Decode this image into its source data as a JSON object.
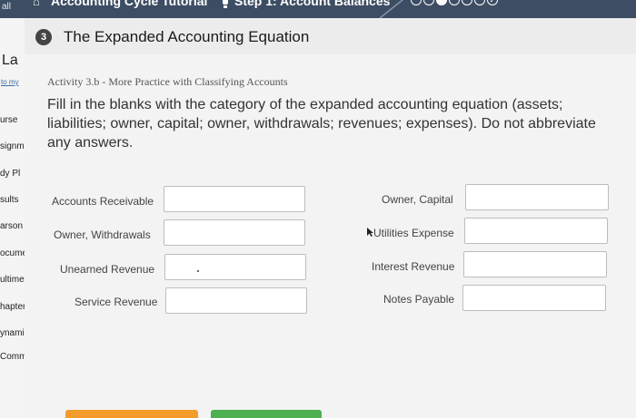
{
  "topbar": {
    "left_text": "all",
    "title": "Accounting Cycle Tutorial",
    "step": "Step 1: Account Balances",
    "progress_dots": [
      "complete",
      "complete",
      "current",
      "upcoming",
      "upcoming",
      "upcoming",
      "final-check"
    ]
  },
  "sidebar": {
    "items": [
      "La",
      "to my",
      "urse",
      "signm",
      "dy Pl",
      "sults",
      "arson",
      "ocume",
      "ultime",
      "hapter",
      "ynamic",
      "Commu"
    ]
  },
  "header": {
    "step_number": "3",
    "title": "The Expanded Accounting Equation"
  },
  "activity": {
    "label": "Activity 3.b - More Practice with Classifying Accounts",
    "instructions": "Fill in the blanks with the category of the expanded accounting equation (assets; liabilities; owner, capital; owner, withdrawals; revenues; expenses). Do not abbreviate any answers."
  },
  "left_items": [
    {
      "label": "Accounts Receivable",
      "value": ""
    },
    {
      "label": "Owner, Withdrawals",
      "value": ""
    },
    {
      "label": "Unearned Revenue",
      "value": ""
    },
    {
      "label": "Service Revenue",
      "value": ""
    }
  ],
  "right_items": [
    {
      "label": "Owner, Capital",
      "value": ""
    },
    {
      "label": "Utilities Expense",
      "value": ""
    },
    {
      "label": "Interest Revenue",
      "value": ""
    },
    {
      "label": "Notes Payable",
      "value": ""
    }
  ],
  "colors": {
    "topbar": "#3d4d63",
    "button_orange": "#f39c2b",
    "button_green": "#4caf50"
  }
}
